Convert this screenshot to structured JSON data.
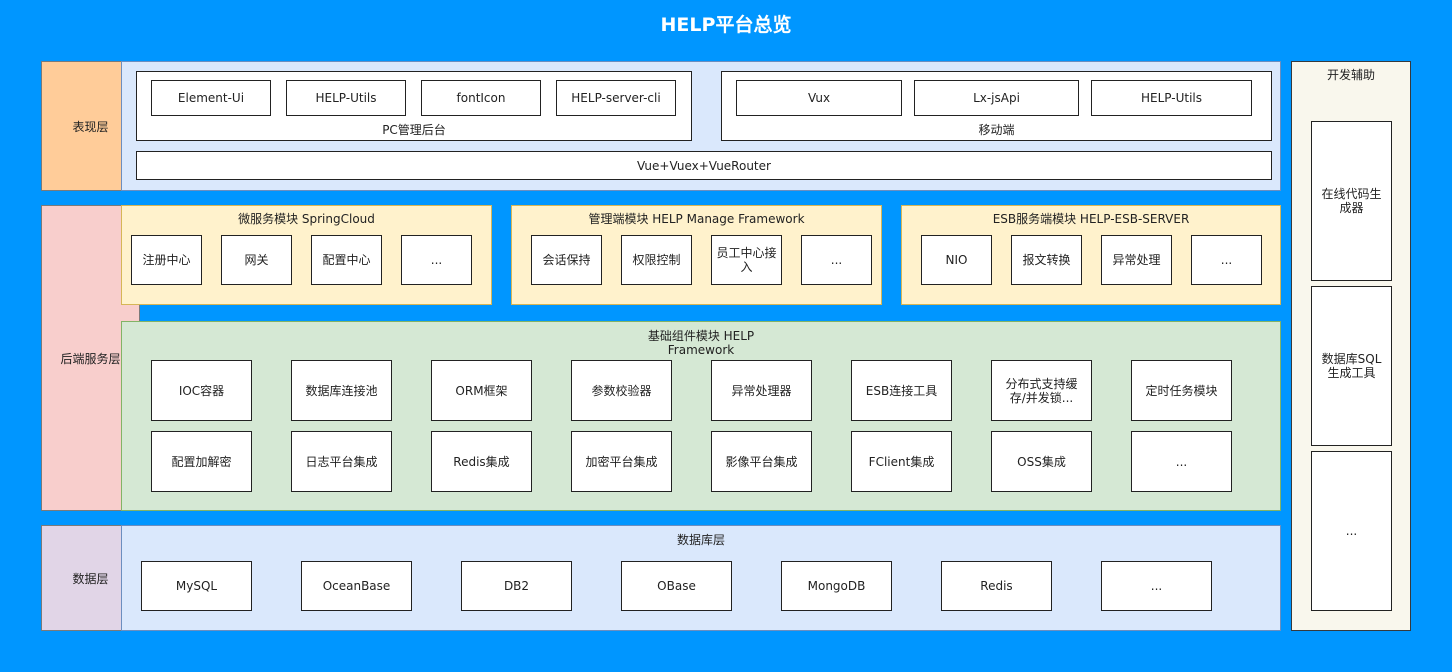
{
  "title": "HELP平台总览",
  "colors": {
    "background": "#0096ff",
    "presentation_label": "#ffcc99",
    "backend_label": "#f8cecc",
    "data_label": "#e1d5e7",
    "blue_panel": "#dae8fc",
    "yellow_panel": "#fff2cc",
    "green_panel": "#d5e8d4",
    "tool_panel": "#f9f7ed"
  },
  "layers": {
    "presentation": "表现层",
    "backend": "后端服务层",
    "data": "数据层"
  },
  "presentation": {
    "pc": {
      "caption": "PC管理后台",
      "items": [
        "Element-Ui",
        "HELP-Utils",
        "fontIcon",
        "HELP-server-cli"
      ]
    },
    "mobile": {
      "caption": "移动端",
      "items": [
        "Vux",
        "Lx-jsApi",
        "HELP-Utils"
      ]
    },
    "base": "Vue+Vuex+VueRouter"
  },
  "backend": {
    "microservice": {
      "title": "微服务模块 SpringCloud",
      "items": [
        "注册中心",
        "网关",
        "配置中心",
        "..."
      ]
    },
    "manage": {
      "title": "管理端模块 HELP Manage Framework",
      "items": [
        "会话保持",
        "权限控制",
        "员工中心接入",
        "..."
      ]
    },
    "esb": {
      "title": "ESB服务端模块 HELP-ESB-SERVER",
      "items": [
        "NIO",
        "报文转换",
        "异常处理",
        "..."
      ]
    },
    "framework": {
      "title_line1": "基础组件模块 HELP",
      "title_line2": "Framework",
      "row1": [
        "IOC容器",
        "数据库连接池",
        "ORM框架",
        "参数校验器",
        "异常处理器",
        "ESB连接工具",
        "分布式支持缓存/并发锁...",
        "定时任务模块"
      ],
      "row2": [
        "配置加解密",
        "日志平台集成",
        "Redis集成",
        "加密平台集成",
        "影像平台集成",
        "FClient集成",
        "OSS集成",
        "..."
      ]
    }
  },
  "data": {
    "title": "数据库层",
    "items": [
      "MySQL",
      "OceanBase",
      "DB2",
      "OBase",
      "MongoDB",
      "Redis",
      "..."
    ]
  },
  "tools": {
    "title": "开发辅助",
    "items": [
      "在线代码生成器",
      "数据库SQL生成工具",
      "..."
    ]
  }
}
